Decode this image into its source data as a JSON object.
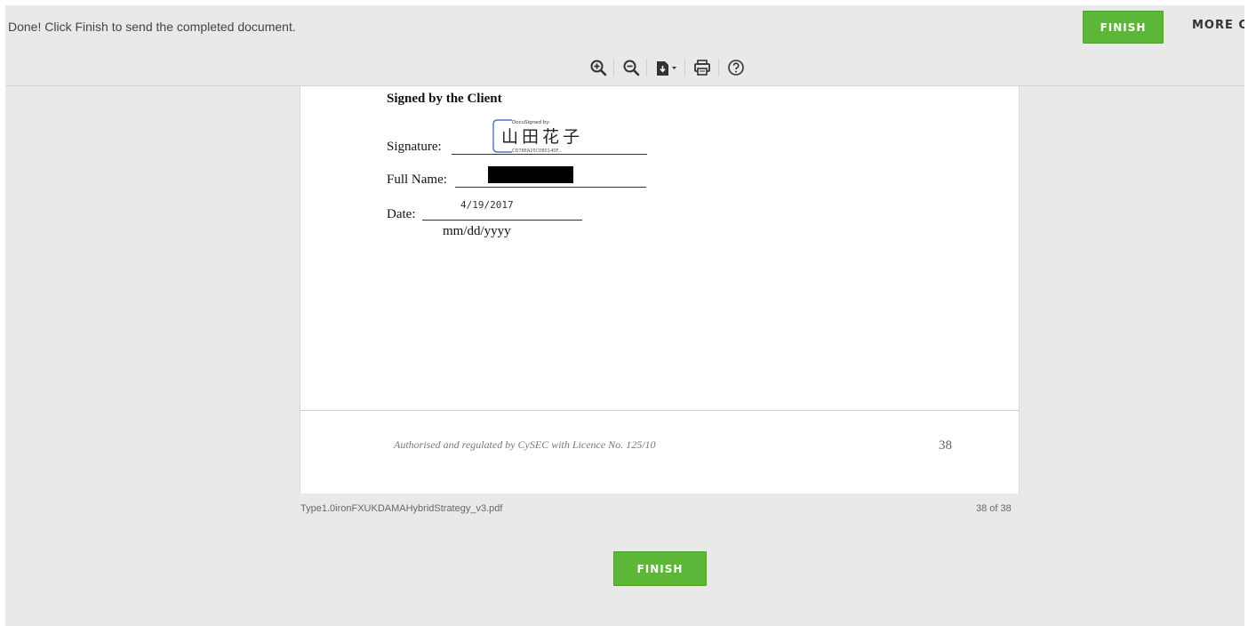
{
  "header": {
    "status_message": "Done! Click Finish to send the completed document.",
    "finish_label": "FINISH",
    "more_options_label": "MORE C"
  },
  "toolbar": {
    "icons": [
      "zoom-in-icon",
      "zoom-out-icon",
      "download-icon",
      "print-icon",
      "help-icon"
    ]
  },
  "document": {
    "heading": "Signed by the Client",
    "signature_label": "Signature:",
    "signature_stamp": {
      "header": "DocuSigned by:",
      "name": "山田花子",
      "id": "CD78EA25C0B5140F..."
    },
    "full_name_label": "Full Name:",
    "date_label": "Date:",
    "date_value": "4/19/2017",
    "date_format_hint": "mm/dd/yyyy",
    "footer_text": "Authorised and regulated by CySEC with Licence No. 125/10",
    "footer_page_number": "38"
  },
  "viewer": {
    "file_name": "Type1.0ironFXUKDAMAHybridStrategy_v3.pdf",
    "page_count": "38 of 38"
  },
  "bottom": {
    "finish_label": "FINISH"
  },
  "colors": {
    "finish_button": "#5cb637",
    "background": "#e9e9e9",
    "signature_border": "#4a78c2"
  }
}
